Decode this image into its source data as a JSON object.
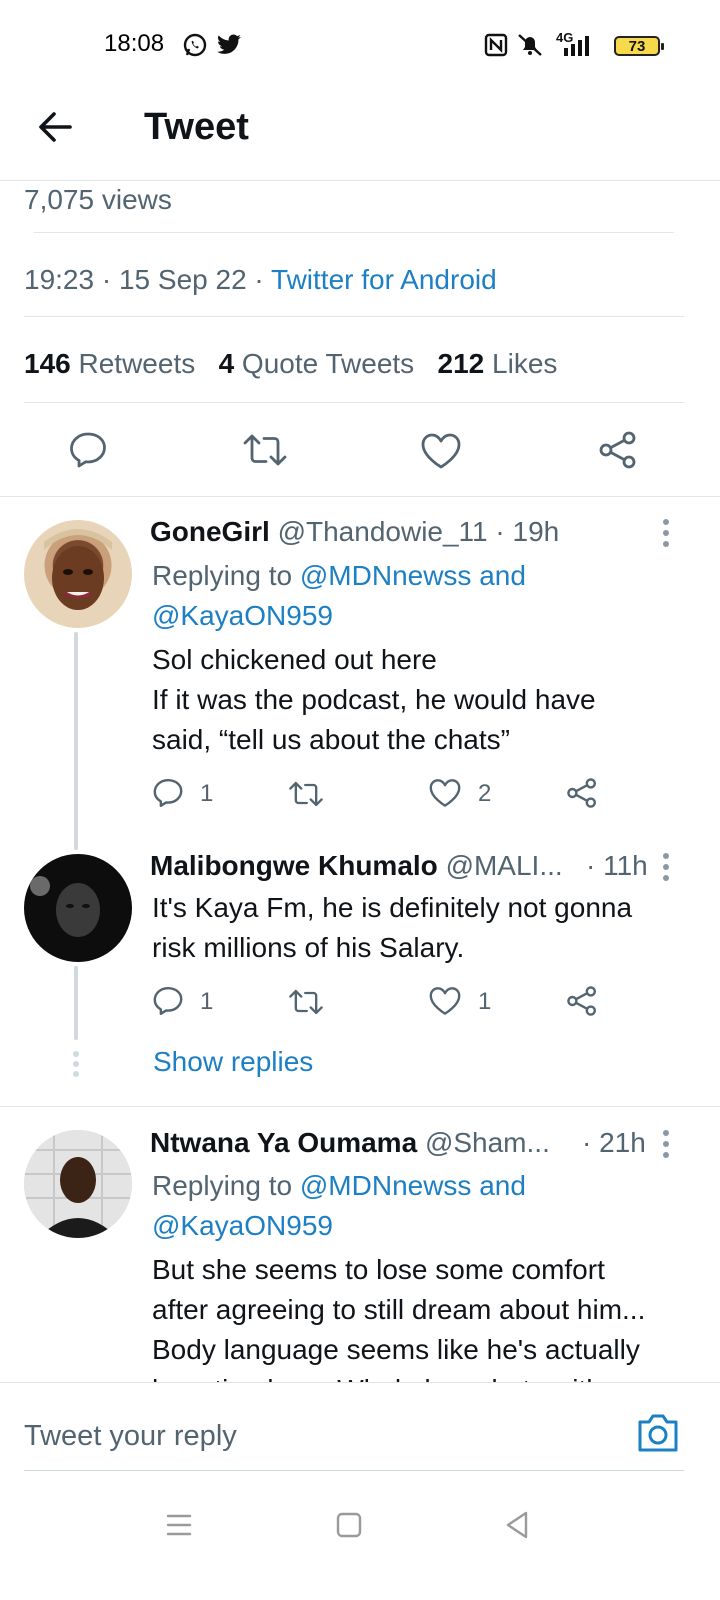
{
  "status_bar": {
    "time": "18:08",
    "network": "4G",
    "battery": "73",
    "icons": [
      "whatsapp-icon",
      "twitter-icon",
      "nfc-icon",
      "mute-icon",
      "signal-icon"
    ]
  },
  "header": {
    "title": "Tweet",
    "back_icon": "arrow-left-icon"
  },
  "tweet": {
    "views": "7,075 views",
    "time": "19:23",
    "date": "15 Sep 22",
    "source": "Twitter for Android",
    "stats": {
      "retweets_count": "146",
      "retweets_label": "Retweets",
      "quotes_count": "4",
      "quotes_label": "Quote Tweets",
      "likes_count": "212",
      "likes_label": "Likes"
    },
    "actions": [
      "reply-icon",
      "retweet-icon",
      "like-icon",
      "share-icon"
    ]
  },
  "replies": [
    {
      "name": "GoneGirl",
      "handle": "@Thandowie_11",
      "time": "· 19h",
      "replying_prefix": "Replying to",
      "replying_to_1": "@MDNnewss and",
      "replying_to_2": "@KayaON959",
      "text_lines": [
        "Sol chickened out here",
        "If it was the podcast, he would have",
        "said, “tell us about the chats”"
      ],
      "reply_count": "1",
      "retweet_count": "",
      "like_count": "2"
    },
    {
      "name": "Malibongwe Khumalo",
      "handle": "@MALI...",
      "time": "· 11h",
      "text_lines": [
        "It's Kaya Fm,  he is definitely not gonna",
        "risk millions of his Salary."
      ],
      "reply_count": "1",
      "retweet_count": "",
      "like_count": "1",
      "show_replies": "Show replies"
    },
    {
      "name": "Ntwana Ya Oumama",
      "handle": "@Sham...",
      "time": "· 21h",
      "replying_prefix": "Replying to",
      "replying_to_1": "@MDNnewss and",
      "replying_to_2": "@KayaON959",
      "text_lines": [
        "But she seems to lose some comfort",
        "after agreeing to still dream about him...",
        "Body language seems like he's actually",
        "haunting her... Whole has chats with"
      ]
    }
  ],
  "compose": {
    "placeholder": "Tweet your reply",
    "camera_icon": "camera-icon"
  },
  "nav_bar": [
    "menu-icon",
    "home-square-icon",
    "back-triangle-icon"
  ],
  "colors": {
    "link_blue": "#1d7fc4",
    "muted_text": "#536471",
    "divider": "#e3e6e8",
    "battery_yellow": "#f7d94c"
  }
}
